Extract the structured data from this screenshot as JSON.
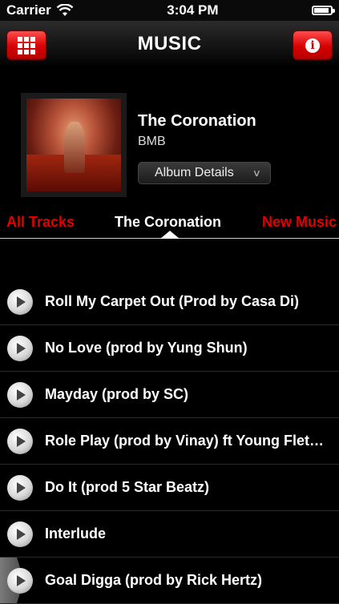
{
  "status": {
    "carrier": "Carrier",
    "time": "3:04 PM",
    "battery_level": 0.9
  },
  "nav": {
    "title": "MUSIC",
    "left_icon": "grid-menu-icon",
    "right_icon": "info-icon"
  },
  "album": {
    "title": "The Coronation",
    "artist": "BMB",
    "details_label": "Album Details"
  },
  "tabs": [
    {
      "label": "All Tracks",
      "selected": false
    },
    {
      "label": "The Coronation",
      "selected": true
    },
    {
      "label": "New Music",
      "selected": false
    }
  ],
  "tracks": [
    {
      "title": "Roll My Carpet Out (Prod by Casa Di)"
    },
    {
      "title": "No Love (prod by Yung Shun)"
    },
    {
      "title": "Mayday (prod by SC)"
    },
    {
      "title": "Role Play (prod by Vinay) ft Young Flet…"
    },
    {
      "title": "Do It (prod 5 Star Beatz)"
    },
    {
      "title": "Interlude"
    },
    {
      "title": "Goal Digga (prod by Rick Hertz)"
    }
  ],
  "colors": {
    "accent": "#e00000",
    "background": "#000000"
  }
}
